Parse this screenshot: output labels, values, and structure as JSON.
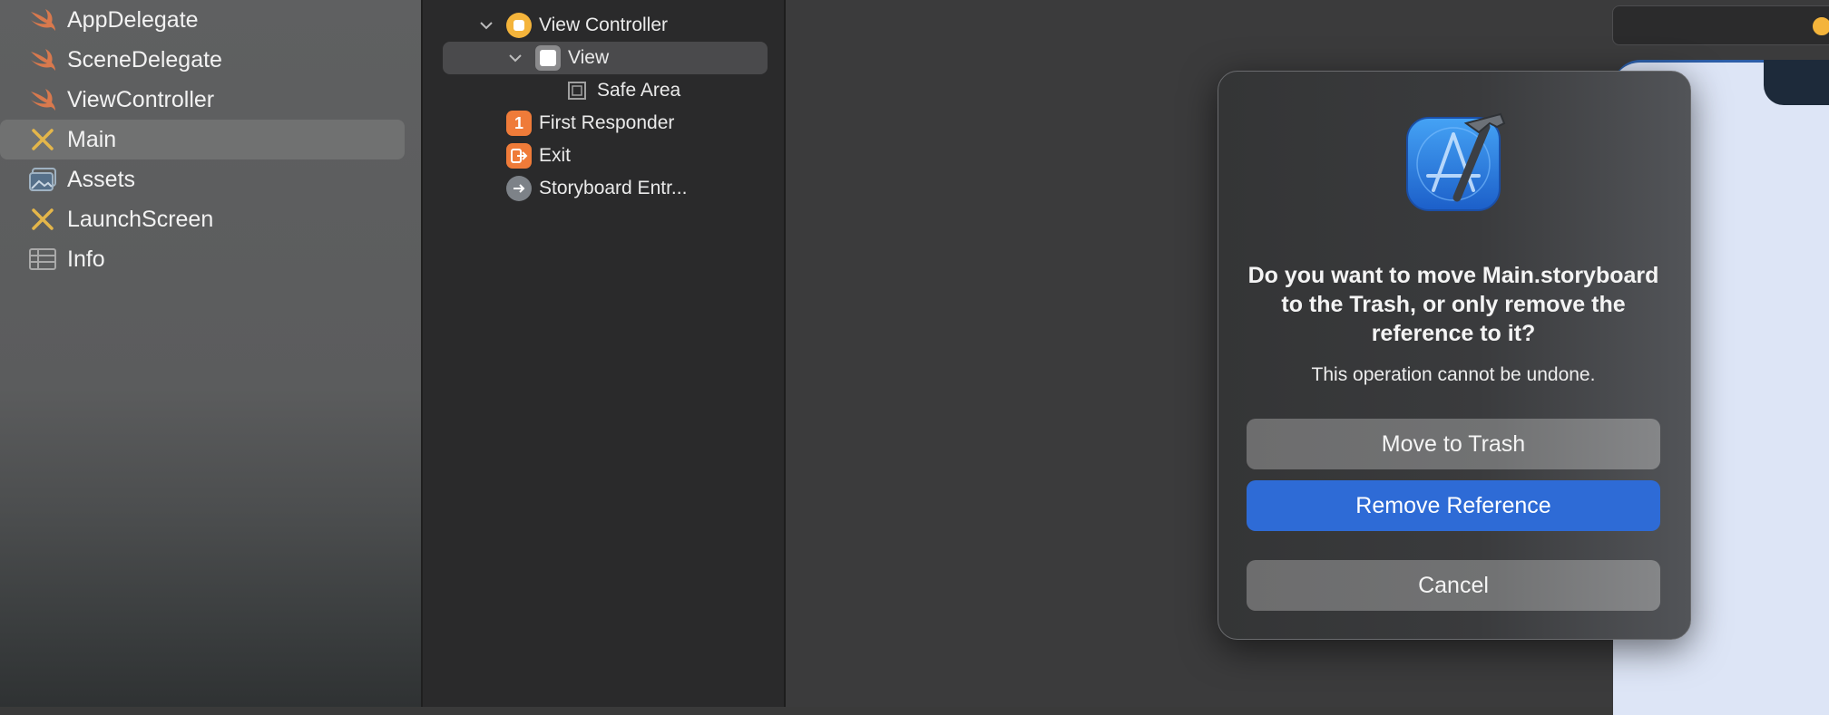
{
  "navigator": {
    "items": [
      {
        "label": "AppDelegate",
        "icon": "swift-file-icon"
      },
      {
        "label": "SceneDelegate",
        "icon": "swift-file-icon"
      },
      {
        "label": "ViewController",
        "icon": "swift-file-icon"
      },
      {
        "label": "Main",
        "icon": "storyboard-file-icon",
        "selected": true
      },
      {
        "label": "Assets",
        "icon": "asset-catalog-icon"
      },
      {
        "label": "LaunchScreen",
        "icon": "storyboard-file-icon"
      },
      {
        "label": "Info",
        "icon": "plist-file-icon"
      }
    ]
  },
  "outline": {
    "items": [
      {
        "label": "View Controller",
        "icon": "view-controller-icon",
        "expanded": true
      },
      {
        "label": "View",
        "icon": "view-icon",
        "expanded": true,
        "selected": true
      },
      {
        "label": "Safe Area",
        "icon": "safe-area-icon"
      },
      {
        "label": "First Responder",
        "icon": "first-responder-icon",
        "glyph": "1"
      },
      {
        "label": "Exit",
        "icon": "exit-icon"
      },
      {
        "label": "Storyboard Entr...",
        "icon": "storyboard-entry-icon"
      }
    ]
  },
  "dialog": {
    "title": "Do you want to move Main.storyboard to the Trash, or only remove the reference to it?",
    "message": "This operation cannot be undone.",
    "buttons": {
      "trash": "Move to Trash",
      "remove": "Remove Reference",
      "cancel": "Cancel"
    },
    "icon": "xcode-app-icon"
  },
  "colors": {
    "accent": "#2e6bd6",
    "swift_orange": "#e27c4b",
    "storyboard_yellow": "#e4b64a",
    "view_controller_yellow": "#f4b43b",
    "first_responder_orange": "#ef7b39"
  }
}
